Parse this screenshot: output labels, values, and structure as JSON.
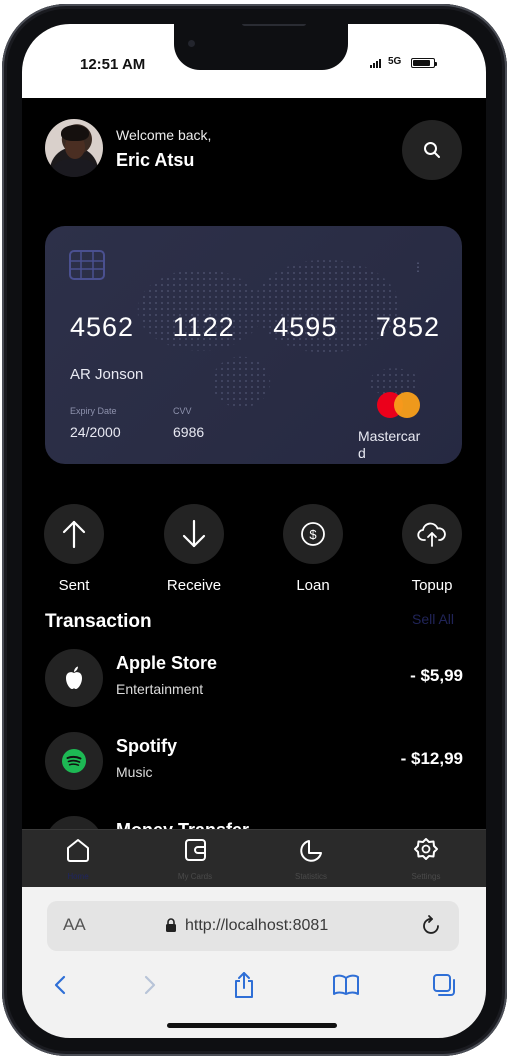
{
  "status_bar": {
    "time": "12:51 AM",
    "network": "5G"
  },
  "header": {
    "welcome": "Welcome back,",
    "user_name": "Eric Atsu"
  },
  "card": {
    "number_groups": [
      "4562",
      "1122",
      "4595",
      "7852"
    ],
    "holder": "AR Jonson",
    "expiry_label": "Expiry Date",
    "expiry_value": "24/2000",
    "cvv_label": "CVV",
    "cvv_value": "6986",
    "brand": "Mastercard",
    "menu_icon": "vertical-dots-icon"
  },
  "actions": [
    {
      "label": "Sent",
      "icon": "arrow-up-icon"
    },
    {
      "label": "Receive",
      "icon": "arrow-down-icon"
    },
    {
      "label": "Loan",
      "icon": "dollar-circle-icon"
    },
    {
      "label": "Topup",
      "icon": "cloud-upload-icon"
    }
  ],
  "transactions": {
    "title": "Transaction",
    "see_all": "Sell All",
    "items": [
      {
        "name": "Apple Store",
        "category": "Entertainment",
        "amount": "- $5,99",
        "icon": "apple-icon"
      },
      {
        "name": "Spotify",
        "category": "Music",
        "amount": "- $12,99",
        "icon": "spotify-icon"
      },
      {
        "name": "Money Transfer"
      }
    ]
  },
  "tabbar": {
    "items": [
      {
        "label": "Home",
        "icon": "home-icon",
        "active": true
      },
      {
        "label": "My Cards",
        "icon": "cards-icon",
        "active": false
      },
      {
        "label": "Statistics",
        "icon": "statistics-icon",
        "active": false
      },
      {
        "label": "Settings",
        "icon": "settings-icon",
        "active": false
      }
    ]
  },
  "browser": {
    "text_size_label": "AA",
    "url": "http://localhost:8081"
  },
  "colors": {
    "app_background": "#000000",
    "card_background": "#2b2e47",
    "circle_button": "#232323",
    "tabbar_background": "#2a2a2a",
    "active_tab_label": "#1f2561",
    "see_all": "#202458",
    "safari_blue": "#2f6fd6",
    "mastercard_red": "#eb001b",
    "mastercard_yellow": "#f79e1b"
  }
}
